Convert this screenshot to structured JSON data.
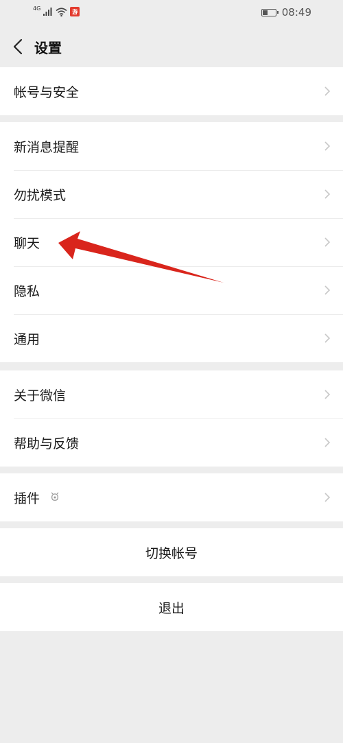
{
  "status_bar": {
    "network": "4G",
    "time": "08:49",
    "battery_level": 0.45,
    "app_badge": "游"
  },
  "nav": {
    "title": "设置"
  },
  "groups": {
    "account": {
      "items": [
        {
          "label": "帐号与安全"
        }
      ]
    },
    "main": {
      "items": [
        {
          "label": "新消息提醒"
        },
        {
          "label": "勿扰模式"
        },
        {
          "label": "聊天"
        },
        {
          "label": "隐私"
        },
        {
          "label": "通用"
        }
      ]
    },
    "about": {
      "items": [
        {
          "label": "关于微信"
        },
        {
          "label": "帮助与反馈"
        }
      ]
    },
    "plugins": {
      "items": [
        {
          "label": "插件"
        }
      ]
    }
  },
  "actions": {
    "switch_account": "切换帐号",
    "logout": "退出"
  },
  "colors": {
    "background": "#ededed",
    "annotation_arrow": "#d9251c"
  }
}
